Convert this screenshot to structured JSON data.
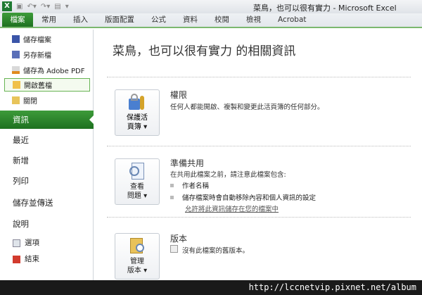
{
  "window": {
    "title": "菜鳥，也可以很有實力 - Microsoft Excel"
  },
  "ribbon_tabs": [
    "檔案",
    "常用",
    "插入",
    "版面配置",
    "公式",
    "資料",
    "校閱",
    "檢視",
    "Acrobat"
  ],
  "backstage": {
    "commands": [
      {
        "label": "儲存檔案",
        "icon": "save-icon"
      },
      {
        "label": "另存新檔",
        "icon": "save-as-icon"
      },
      {
        "label": "儲存為 Adobe PDF",
        "icon": "pdf-icon"
      },
      {
        "label": "開啟舊檔",
        "icon": "open-folder-icon"
      },
      {
        "label": "關閉",
        "icon": "close-folder-icon"
      }
    ],
    "nav": [
      "資訊",
      "最近",
      "新增",
      "列印",
      "儲存並傳送",
      "說明"
    ],
    "bottom": [
      {
        "label": "選項",
        "icon": "options-icon"
      },
      {
        "label": "結束",
        "icon": "exit-icon"
      }
    ]
  },
  "info": {
    "heading": "菜鳥，也可以很有實力 的相關資訊",
    "permissions": {
      "button": "保護活頁簿 ▾",
      "button_l1": "保護活",
      "button_l2": "頁簿 ▾",
      "title": "權限",
      "desc": "任何人都能開啟、複製和變更此活頁簿的任何部分。"
    },
    "prepare": {
      "button_l1": "查看",
      "button_l2": "問題 ▾",
      "title": "準備共用",
      "desc": "在共用此檔案之前，請注意此檔案包含:",
      "bullets": [
        "作者名稱",
        "儲存檔案時會自動移除內容和個人資訊的設定"
      ],
      "link": "允許將此資訊儲存在您的檔案中"
    },
    "versions": {
      "button_l1": "管理",
      "button_l2": "版本 ▾",
      "title": "版本",
      "desc": "沒有此檔案的舊版本。"
    }
  },
  "watermark": "http://lccnetvip.pixnet.net/album"
}
